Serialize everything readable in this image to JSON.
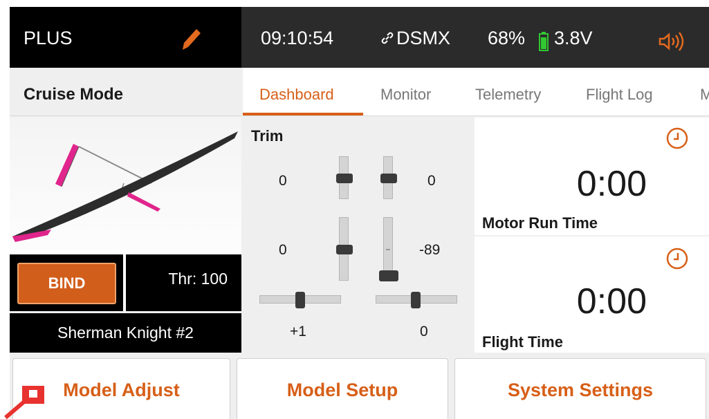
{
  "topbar": {
    "model_short": "PLUS",
    "time": "09:10:54",
    "link": "DSMX",
    "battery_percent": "68%",
    "voltage": "3.8V"
  },
  "mode": "Cruise Mode",
  "tabs": [
    "Dashboard",
    "Monitor",
    "Telemetry",
    "Flight Log",
    "M"
  ],
  "active_tab": "Dashboard",
  "bind_label": "BIND",
  "throttle": "Thr: 100",
  "model_name": "Sherman Knight #2",
  "trim": {
    "title": "Trim",
    "values": {
      "left_upper": "0",
      "right_upper": "0",
      "left_lower": "0",
      "right_lower": "-89",
      "horiz_left": "+1",
      "horiz_right": "0"
    }
  },
  "timers": [
    {
      "value": "0:00",
      "label": "Motor Run Time"
    },
    {
      "value": "0:00",
      "label": "Flight Time"
    }
  ],
  "bottom_buttons": [
    "Model Adjust",
    "Model Setup",
    "System Settings"
  ],
  "colors": {
    "accent": "#d75f18",
    "battery": "#32c832",
    "wing_tip": "#e0258c"
  },
  "icons": {
    "edit": "pencil-icon",
    "link": "link-icon",
    "battery": "battery-icon",
    "speaker": "speaker-icon",
    "timer": "clock-icon"
  }
}
